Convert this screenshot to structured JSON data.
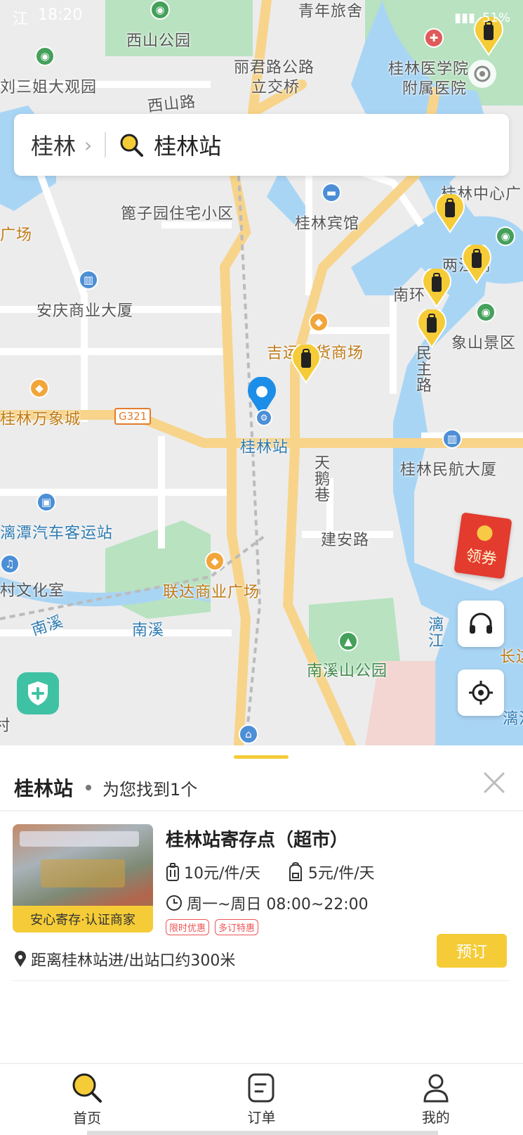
{
  "status": {
    "carrier": "江",
    "time": "18:20",
    "battery": "51%"
  },
  "search": {
    "city": "桂林",
    "query": "桂林站"
  },
  "map": {
    "labels": {
      "qingnian": "青年旅舍",
      "xishan_park": "西山公园",
      "lijun_bridge1": "丽君路公路",
      "lijun_bridge2": "立交桥",
      "hospital1": "桂林医学院",
      "hospital2": "附属医院",
      "liusanjie": "刘三姐大观园",
      "xishan_road": "西山路",
      "zhongxin": "桂林中心广",
      "kuangzi": "篦子园住宅小区",
      "binguan": "桂林宾馆",
      "guangchang": "广场",
      "lianghu": "两江湖",
      "nanhuan": "南环",
      "anqing": "安庆商业大厦",
      "xiangshan": "象山景区",
      "jiyun": "吉运百货商场",
      "minzhu": "民主路",
      "wanxiang": "桂林万象城",
      "g321": "G321",
      "station": "桂林站",
      "minhang": "桂林民航大厦",
      "tiane": "天鹅巷",
      "bus": "漓潭汽车客运站",
      "jianan": "建安路",
      "wenhua": "村文化室",
      "lianda": "联达商业广场",
      "nanxi1": "南溪",
      "nanxi2": "南溪",
      "lijiang1": "漓江",
      "nanxishan": "南溪山公园",
      "chang": "长边",
      "lijiang2": "漓江",
      "cut": "村"
    },
    "coupon_label": "领券"
  },
  "sheet": {
    "title": "桂林站",
    "count": "为您找到1个",
    "store": {
      "name": "桂林站寄存点（超市）",
      "badge": "安心寄存·认证商家",
      "price_luggage": "10元/件/天",
      "price_bag": "5元/件/天",
      "hours": "周一~周日 08:00~22:00",
      "tags": [
        "限时优惠",
        "多订特惠"
      ],
      "distance": "距离桂林站进/出站口约300米",
      "book_label": "预订"
    }
  },
  "tabs": [
    {
      "label": "首页",
      "icon": "search-icon"
    },
    {
      "label": "订单",
      "icon": "order-icon"
    },
    {
      "label": "我的",
      "icon": "profile-icon"
    }
  ],
  "colors": {
    "accent": "#f5cc37",
    "water": "#a7d4f7",
    "park": "#b6e0bf",
    "road": "#f7d58a"
  }
}
